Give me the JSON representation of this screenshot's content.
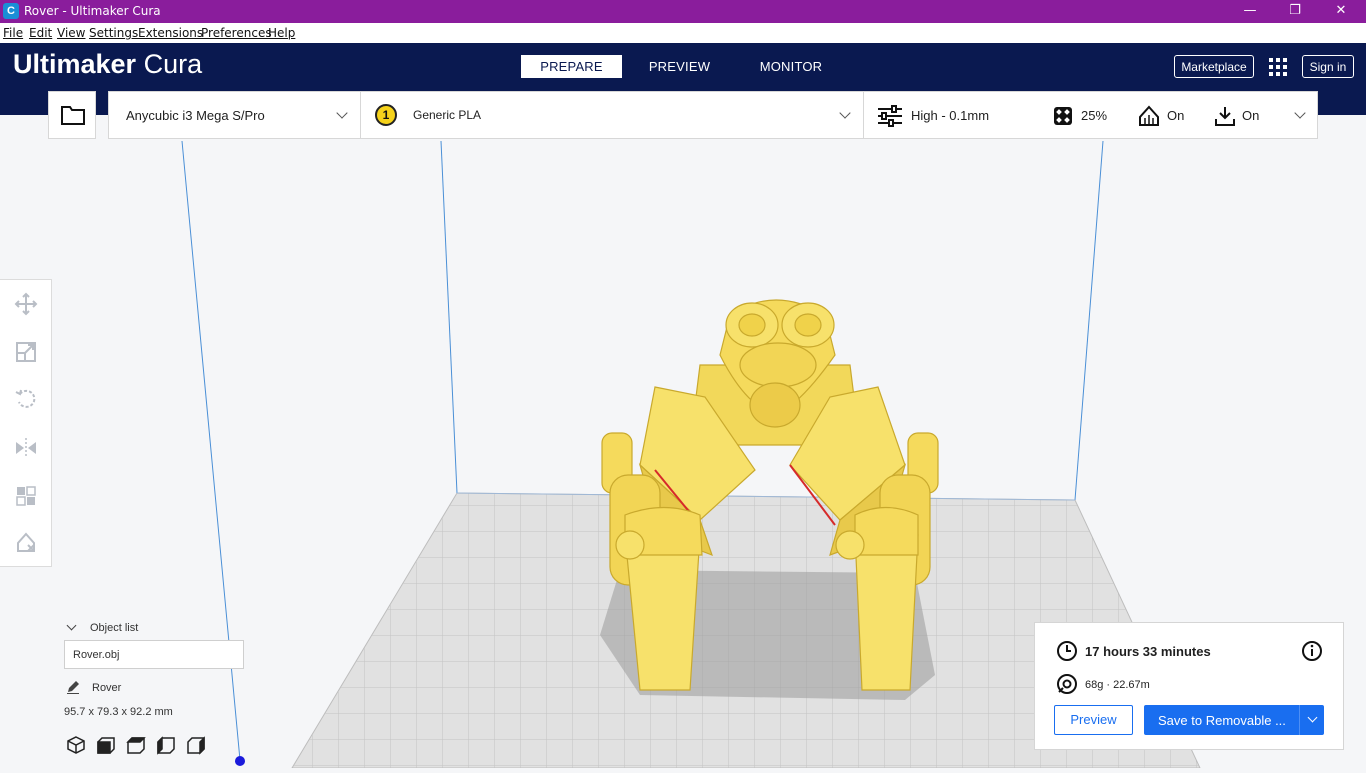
{
  "window": {
    "title": "Rover - Ultimaker Cura",
    "app_icon_letter": "C",
    "controls": [
      "—",
      "❐",
      "✕"
    ]
  },
  "menu": [
    "File",
    "Edit",
    "View",
    "Settings",
    "Extensions",
    "Preferences",
    "Help"
  ],
  "header": {
    "logo_bold": "Ultimaker",
    "logo_light": " Cura",
    "stages": [
      "PREPARE",
      "PREVIEW",
      "MONITOR"
    ],
    "marketplace_label": "Marketplace",
    "signin_label": "Sign in"
  },
  "toolbar": {
    "printer": "Anycubic i3 Mega S/Pro",
    "extruder_number": "1",
    "material": "Generic PLA",
    "profile": "High - 0.1mm",
    "infill": "25%",
    "support": "On",
    "adhesion": "On"
  },
  "tools": [
    "move-icon",
    "scale-icon",
    "rotate-icon",
    "mirror-icon",
    "per-model-settings-icon",
    "support-blocker-icon"
  ],
  "object_list": {
    "header": "Object list",
    "file": "Rover.obj",
    "object_name": "Rover",
    "dimensions": "95.7 x 79.3 x 92.2 mm"
  },
  "print_info": {
    "time": "17 hours 33 minutes",
    "material_usage": "68g · 22.67m",
    "preview_button": "Preview",
    "save_button": "Save to Removable ..."
  },
  "colors": {
    "title_bar": "#8a1d9c",
    "header": "#0a1950",
    "accent": "#196ef0",
    "model": "#f7e16b"
  }
}
